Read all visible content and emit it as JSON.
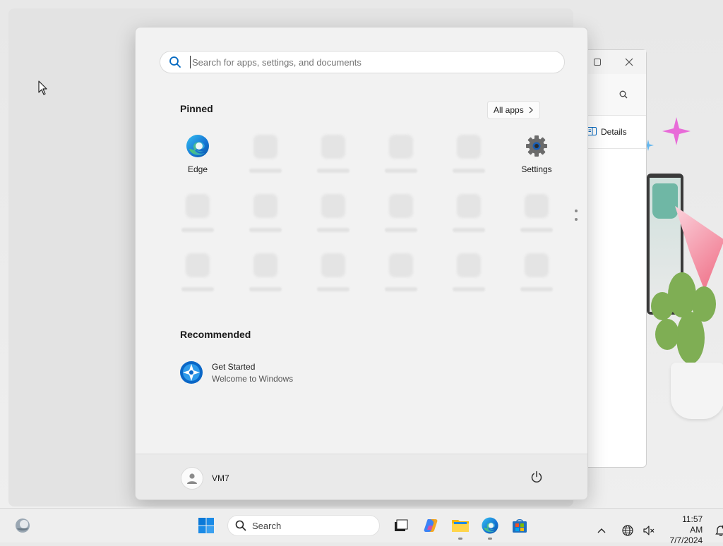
{
  "colors": {
    "accent": "#0067c0",
    "edge_blue": "#1e88e5",
    "edge_green": "#4fc34a",
    "settings_gray": "#6b6b6b"
  },
  "background_window": {
    "details_label": "Details",
    "icons": [
      "maximize-icon",
      "close-icon",
      "search-icon",
      "details-pane-icon"
    ]
  },
  "start_menu": {
    "search": {
      "placeholder": "Search for apps, settings, and documents",
      "value": ""
    },
    "pinned": {
      "title": "Pinned",
      "all_apps_label": "All apps",
      "apps": [
        {
          "label": "Edge",
          "icon": "edge-icon"
        },
        {
          "label": "",
          "icon": "placeholder"
        },
        {
          "label": "",
          "icon": "placeholder"
        },
        {
          "label": "",
          "icon": "placeholder"
        },
        {
          "label": "",
          "icon": "placeholder"
        },
        {
          "label": "Settings",
          "icon": "settings-icon"
        }
      ]
    },
    "recommended": {
      "title": "Recommended",
      "items": [
        {
          "title": "Get Started",
          "subtitle": "Welcome to Windows",
          "icon": "get-started-icon"
        }
      ]
    },
    "footer": {
      "user_name": "VM7",
      "power_icon": "power-icon"
    }
  },
  "taskbar": {
    "search_label": "Search",
    "apps": [
      "start-icon",
      "task-view-icon",
      "copilot-icon",
      "file-explorer-icon",
      "edge-icon",
      "store-icon"
    ],
    "tray": {
      "icons": [
        "chevron-up-icon",
        "network-icon",
        "volume-muted-icon",
        "notification-icon"
      ],
      "time": "11:57 AM",
      "date": "7/7/2024"
    }
  }
}
